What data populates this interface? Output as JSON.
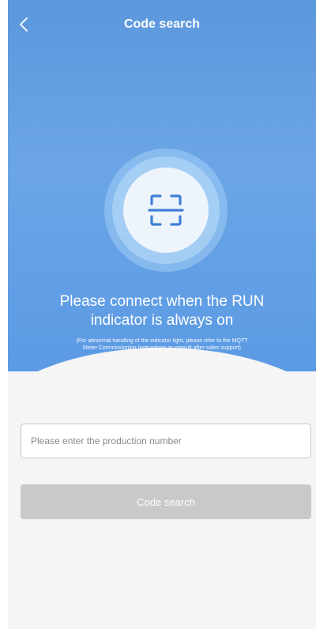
{
  "nav": {
    "title": "Code search",
    "back_icon": "chevron-left-icon"
  },
  "hero": {
    "scan_icon": "scan-frame-icon",
    "headline_line1": "Please connect when the RUN",
    "headline_line2": "indicator is always on",
    "note_line1": "(For abnormal handling of the indicator light, please refer to the MQTT",
    "note_line2": "Meter Commissioning Instructions or consult after-sales support)"
  },
  "form": {
    "production_number_placeholder": "Please enter the production number",
    "production_number_value": "",
    "submit_label": "Code search"
  },
  "colors": {
    "hero_blue": "#5b9ae4",
    "button_disabled": "#c9c9cc",
    "background": "#f5f5f6"
  }
}
